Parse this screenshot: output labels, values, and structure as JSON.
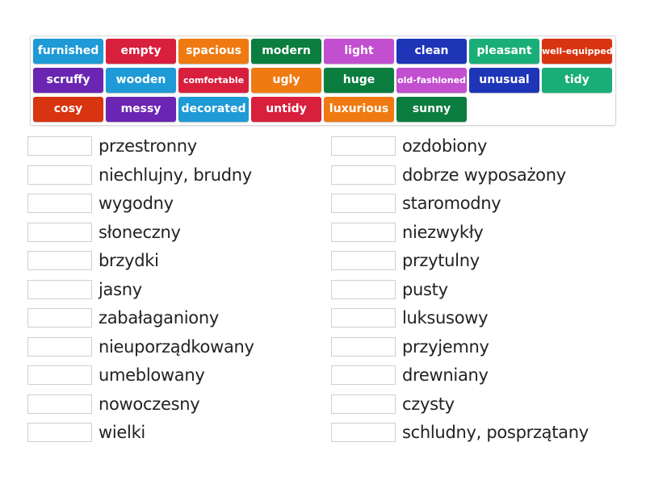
{
  "tiles": [
    {
      "label": "furnished",
      "color": "#1e9ad6"
    },
    {
      "label": "empty",
      "color": "#d81f3c"
    },
    {
      "label": "spacious",
      "color": "#f07a12"
    },
    {
      "label": "modern",
      "color": "#0b7d3e"
    },
    {
      "label": "light",
      "color": "#c24fcf"
    },
    {
      "label": "clean",
      "color": "#1e35b8"
    },
    {
      "label": "pleasant",
      "color": "#19ae78"
    },
    {
      "label": "well-equipped",
      "color": "#d8340f"
    },
    {
      "label": "scruffy",
      "color": "#6a25b3"
    },
    {
      "label": "wooden",
      "color": "#1e9ad6"
    },
    {
      "label": "comfortable",
      "color": "#d81f3c"
    },
    {
      "label": "ugly",
      "color": "#f07a12"
    },
    {
      "label": "huge",
      "color": "#0b7d3e"
    },
    {
      "label": "old-fashioned",
      "color": "#c24fcf"
    },
    {
      "label": "unusual",
      "color": "#1e35b8"
    },
    {
      "label": "tidy",
      "color": "#19ae78"
    },
    {
      "label": "cosy",
      "color": "#d8340f"
    },
    {
      "label": "messy",
      "color": "#6a25b3"
    },
    {
      "label": "decorated",
      "color": "#1e9ad6"
    },
    {
      "label": "untidy",
      "color": "#d81f3c"
    },
    {
      "label": "luxurious",
      "color": "#f07a12"
    },
    {
      "label": "sunny",
      "color": "#0b7d3e"
    }
  ],
  "left_column": [
    "przestronny",
    "niechlujny, brudny",
    "wygodny",
    "słoneczny",
    "brzydki",
    "jasny",
    "zabałaganiony",
    "nieuporządkowany",
    "umeblowany",
    "nowoczesny",
    "wielki"
  ],
  "right_column": [
    "ozdobiony",
    "dobrze wyposażony",
    "staromodny",
    "niezwykły",
    "przytulny",
    "pusty",
    "luksusowy",
    "przyjemny",
    "drewniany",
    "czysty",
    "schludny, posprzątany"
  ]
}
